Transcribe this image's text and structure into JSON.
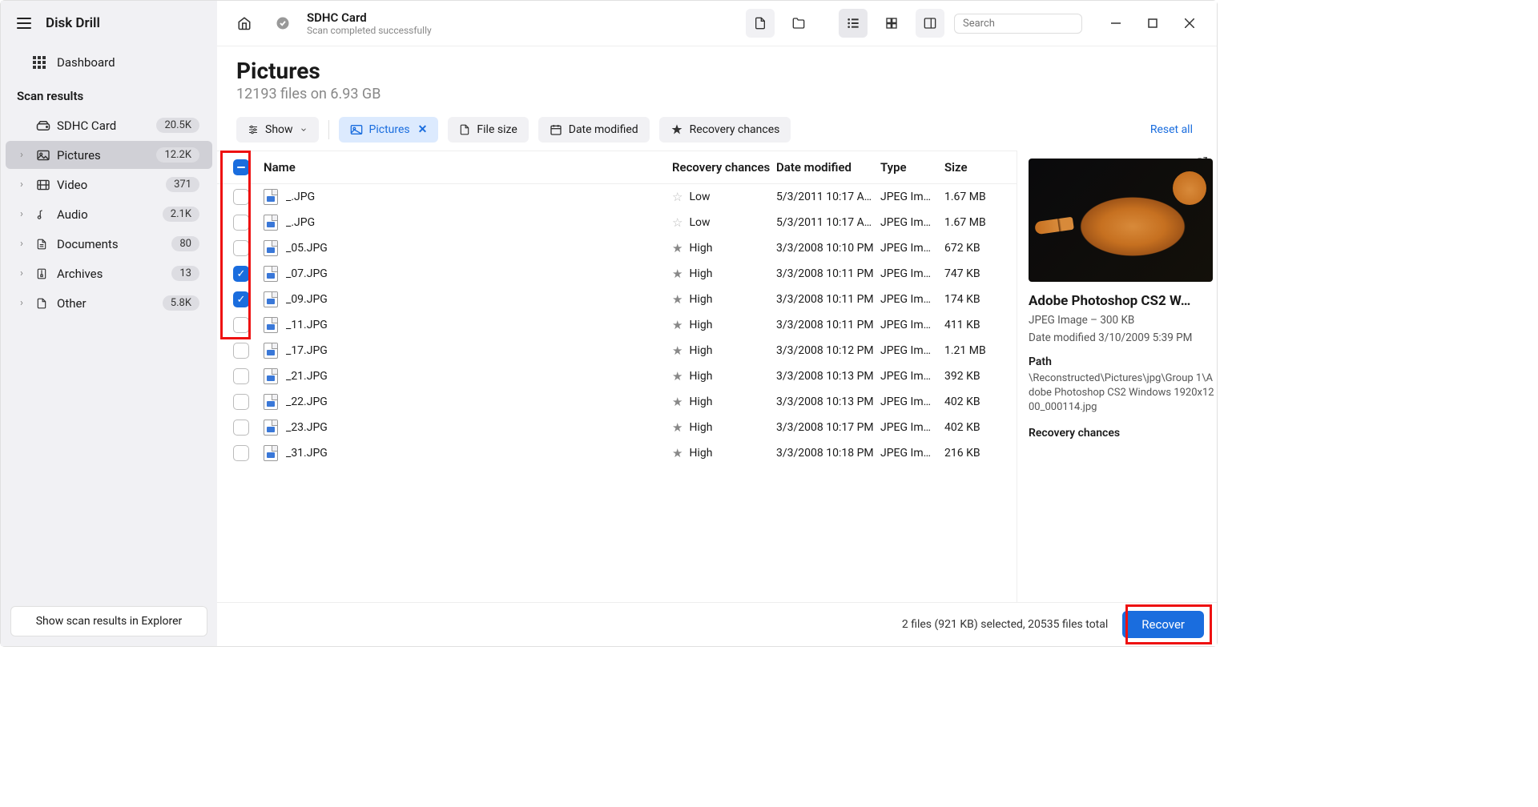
{
  "app": {
    "name": "Disk Drill"
  },
  "sidebar": {
    "dashboard": "Dashboard",
    "section": "Scan results",
    "items": [
      {
        "label": "SDHC Card",
        "count": "20.5K",
        "icon": "drive"
      },
      {
        "label": "Pictures",
        "count": "12.2K",
        "icon": "image",
        "active": true
      },
      {
        "label": "Video",
        "count": "371",
        "icon": "film"
      },
      {
        "label": "Audio",
        "count": "2.1K",
        "icon": "music"
      },
      {
        "label": "Documents",
        "count": "80",
        "icon": "doc"
      },
      {
        "label": "Archives",
        "count": "13",
        "icon": "zip"
      },
      {
        "label": "Other",
        "count": "5.8K",
        "icon": "page"
      }
    ],
    "explorer_btn": "Show scan results in Explorer"
  },
  "header": {
    "device": "SDHC Card",
    "status": "Scan completed successfully",
    "search_placeholder": "Search"
  },
  "page": {
    "title": "Pictures",
    "subtitle": "12193 files on 6.93 GB"
  },
  "filters": {
    "show": "Show",
    "chips": [
      {
        "label": "Pictures",
        "active": true,
        "icon": "image"
      },
      {
        "label": "File size",
        "icon": "doc"
      },
      {
        "label": "Date modified",
        "icon": "calendar"
      },
      {
        "label": "Recovery chances",
        "icon": "star"
      }
    ],
    "reset": "Reset all"
  },
  "table": {
    "columns": {
      "name": "Name",
      "rec": "Recovery chances",
      "date": "Date modified",
      "type": "Type",
      "size": "Size"
    },
    "rows": [
      {
        "name": "_.JPG",
        "rec": "Low",
        "date": "5/3/2011 10:17 A…",
        "type": "JPEG Im…",
        "size": "1.67 MB",
        "checked": false
      },
      {
        "name": "_.JPG",
        "rec": "Low",
        "date": "5/3/2011 10:17 A…",
        "type": "JPEG Im…",
        "size": "1.67 MB",
        "checked": false
      },
      {
        "name": "_05.JPG",
        "rec": "High",
        "date": "3/3/2008 10:10 PM",
        "type": "JPEG Im…",
        "size": "672 KB",
        "checked": false
      },
      {
        "name": "_07.JPG",
        "rec": "High",
        "date": "3/3/2008 10:11 PM",
        "type": "JPEG Im…",
        "size": "747 KB",
        "checked": true
      },
      {
        "name": "_09.JPG",
        "rec": "High",
        "date": "3/3/2008 10:11 PM",
        "type": "JPEG Im…",
        "size": "174 KB",
        "checked": true
      },
      {
        "name": "_11.JPG",
        "rec": "High",
        "date": "3/3/2008 10:11 PM",
        "type": "JPEG Im…",
        "size": "411 KB",
        "checked": false
      },
      {
        "name": "_17.JPG",
        "rec": "High",
        "date": "3/3/2008 10:12 PM",
        "type": "JPEG Im…",
        "size": "1.21 MB",
        "checked": false
      },
      {
        "name": "_21.JPG",
        "rec": "High",
        "date": "3/3/2008 10:13 PM",
        "type": "JPEG Im…",
        "size": "392 KB",
        "checked": false
      },
      {
        "name": "_22.JPG",
        "rec": "High",
        "date": "3/3/2008 10:13 PM",
        "type": "JPEG Im…",
        "size": "402 KB",
        "checked": false
      },
      {
        "name": "_23.JPG",
        "rec": "High",
        "date": "3/3/2008 10:17 PM",
        "type": "JPEG Im…",
        "size": "402 KB",
        "checked": false
      },
      {
        "name": "_31.JPG",
        "rec": "High",
        "date": "3/3/2008 10:18 PM",
        "type": "JPEG Im…",
        "size": "216 KB",
        "checked": false
      }
    ]
  },
  "preview": {
    "title": "Adobe Photoshop CS2 W…",
    "meta1": "JPEG Image – 300 KB",
    "meta2": "Date modified 3/10/2009 5:39 PM",
    "path_label": "Path",
    "path": "\\Reconstructed\\Pictures\\jpg\\Group 1\\Adobe Photoshop CS2 Windows 1920x1200_000114.jpg",
    "rc_label": "Recovery chances"
  },
  "footer": {
    "status": "2 files (921 KB) selected, 20535 files total",
    "recover": "Recover"
  }
}
